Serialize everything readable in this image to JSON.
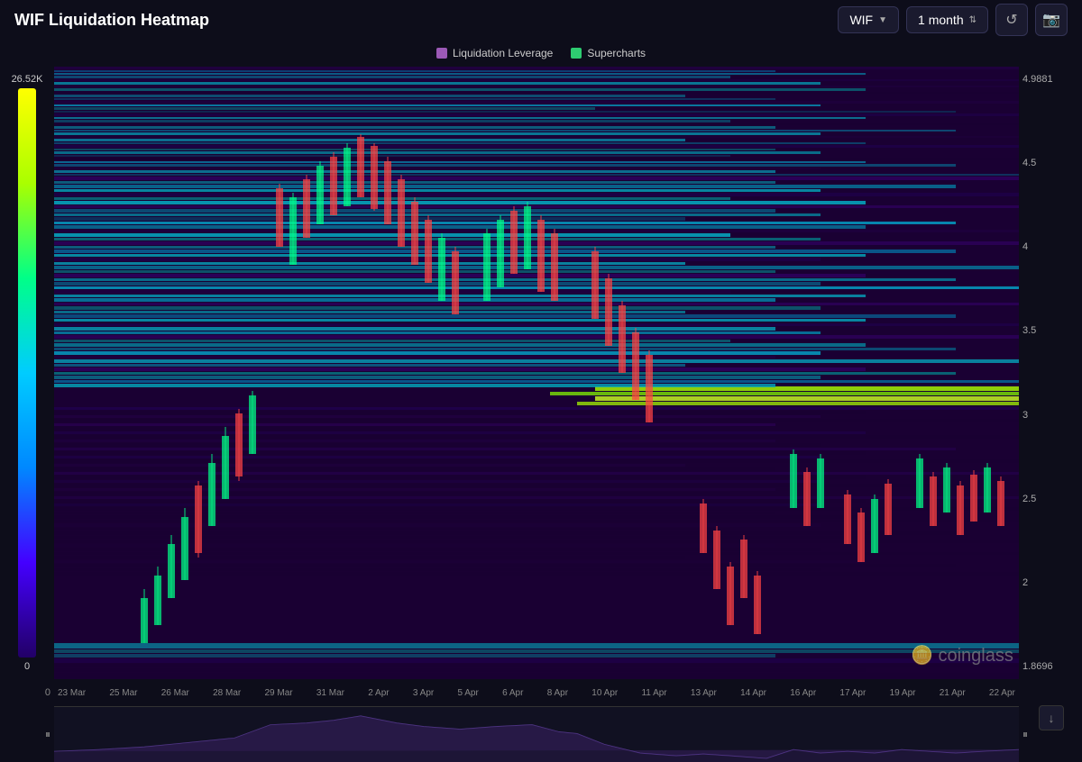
{
  "header": {
    "title": "WIF Liquidation Heatmap",
    "asset_selector": {
      "value": "WIF",
      "label": "WIF"
    },
    "time_selector": {
      "value": "1 month",
      "label": "1 month"
    },
    "refresh_icon": "↺",
    "camera_icon": "📷"
  },
  "legend": {
    "items": [
      {
        "label": "Liquidation Leverage",
        "color": "#9b59b6"
      },
      {
        "label": "Supercharts",
        "color": "#2ecc71"
      }
    ]
  },
  "color_scale": {
    "top_label": "26.52K",
    "bottom_label": "0"
  },
  "price_axis": {
    "labels": [
      "4.9881",
      "4.5",
      "4",
      "3.5",
      "3",
      "2.5",
      "2",
      "1.8696"
    ]
  },
  "x_axis": {
    "labels": [
      "0",
      "23 Mar",
      "25 Mar",
      "26 Mar",
      "28 Mar",
      "29 Mar",
      "31 Mar",
      "2 Apr",
      "3 Apr",
      "5 Apr",
      "6 Apr",
      "8 Apr",
      "10 Apr",
      "11 Apr",
      "13 Apr",
      "14 Apr",
      "16 Apr",
      "17 Apr",
      "19 Apr",
      "21 Apr",
      "22 Apr"
    ]
  },
  "watermark": {
    "text": "coinglass",
    "icon": "🍪"
  }
}
